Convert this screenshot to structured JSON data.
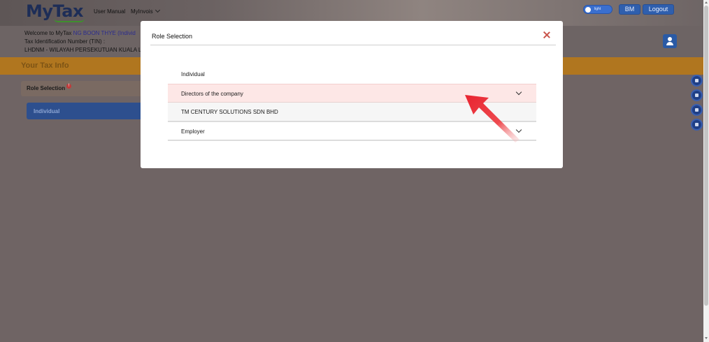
{
  "header": {
    "logo": "MyTax",
    "nav": [
      {
        "label": "User Manual"
      },
      {
        "label": "MyInvois"
      }
    ],
    "theme_toggle_label": "light",
    "language_button": "BM",
    "logout_button": "Logout"
  },
  "welcome": {
    "greeting": "Welcome to MyTax",
    "user_name": "NG BOON THYE (Individ",
    "tin_label": "Tax Identification Number (TIN) :",
    "office": "LHDNM - WILAYAH PERSEKUTUAN KUALA LU"
  },
  "page": {
    "section_title": "Your Tax Info",
    "role_selection_label": "Role Selection",
    "current_role_button": "Individual"
  },
  "modal": {
    "title": "Role Selection",
    "rows": [
      {
        "label": "Individual"
      },
      {
        "label": "Directors of the company"
      },
      {
        "label": "TM CENTURY SOLUTIONS SDN BHD"
      },
      {
        "label": "Employer"
      }
    ]
  },
  "colors": {
    "brand_navy": "#1d2d57",
    "accent_blue": "#2f5fae",
    "selected_row": "#fde7e6",
    "tax_band": "#b0761f",
    "annotation_arrow": "#e8323c"
  }
}
